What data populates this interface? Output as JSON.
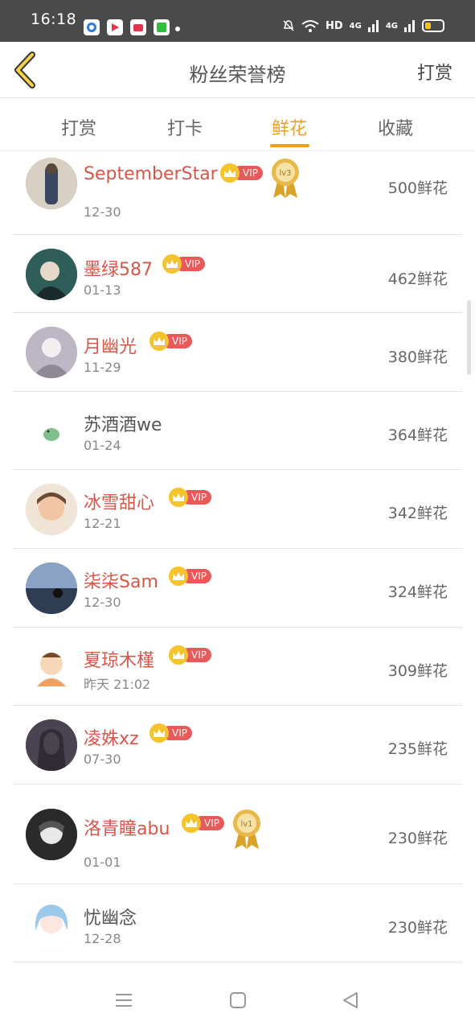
{
  "status_bar": {
    "time": "16:18",
    "network": "HD",
    "signal_1": "4G",
    "signal_2": "4G"
  },
  "header": {
    "title": "粉丝荣誉榜",
    "action": "打赏"
  },
  "tabs": [
    {
      "label": "打赏",
      "active": false
    },
    {
      "label": "打卡",
      "active": false
    },
    {
      "label": "鲜花",
      "active": true
    },
    {
      "label": "收藏",
      "active": false
    }
  ],
  "list": [
    {
      "name": "SeptemberStar",
      "vip": true,
      "vip_label": "VIP",
      "medal": "lv3",
      "date": "12-30",
      "count": "500鲜花",
      "avatar_color": "#8c7a6b"
    },
    {
      "name": "墨绿587",
      "vip": true,
      "vip_label": "VIP",
      "medal": "",
      "date": "01-13",
      "count": "462鲜花",
      "avatar_color": "#3a6f6a"
    },
    {
      "name": "月幽光",
      "vip": true,
      "vip_label": "VIP",
      "medal": "",
      "date": "11-29",
      "count": "380鲜花",
      "avatar_color": "#cfc8d4"
    },
    {
      "name": "苏酒酒we",
      "vip": false,
      "vip_label": "",
      "medal": "",
      "date": "01-24",
      "count": "364鲜花",
      "avatar_color": "#7fbf8a"
    },
    {
      "name": "冰雪甜心",
      "vip": true,
      "vip_label": "VIP",
      "medal": "",
      "date": "12-21",
      "count": "342鲜花",
      "avatar_color": "#e3c4a8"
    },
    {
      "name": "柒柒Sam",
      "vip": true,
      "vip_label": "VIP",
      "medal": "",
      "date": "12-30",
      "count": "324鲜花",
      "avatar_color": "#4f6a8a"
    },
    {
      "name": "夏琼木槿",
      "vip": true,
      "vip_label": "VIP",
      "medal": "",
      "date": "昨天 21:02",
      "count": "309鲜花",
      "avatar_color": "#f0a060"
    },
    {
      "name": "凌姝xz",
      "vip": true,
      "vip_label": "VIP",
      "medal": "",
      "date": "07-30",
      "count": "235鲜花",
      "avatar_color": "#5a5060"
    },
    {
      "name": "洛青瞳abu",
      "vip": true,
      "vip_label": "VIP",
      "medal": "lv1",
      "date": "01-01",
      "count": "230鲜花",
      "avatar_color": "#3a3a3a"
    },
    {
      "name": "忧幽念",
      "vip": false,
      "vip_label": "",
      "medal": "",
      "date": "12-28",
      "count": "230鲜花",
      "avatar_color": "#a9cde8"
    }
  ],
  "colors": {
    "accent": "#f0a020",
    "name_vip": "#d6574a",
    "vip_badge": "#e85a5a",
    "crown": "#f5c32c"
  },
  "icons": {
    "back": "chevron-left-icon",
    "menu": "menu-icon",
    "home": "home-square-icon",
    "back_nav": "triangle-back-icon"
  }
}
